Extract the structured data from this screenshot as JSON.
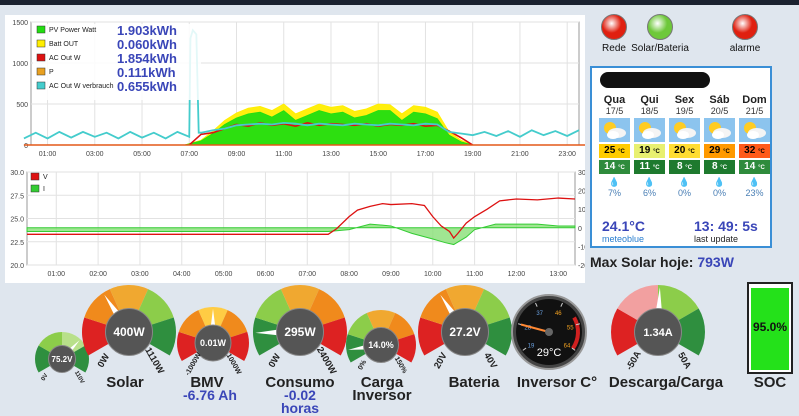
{
  "chart_data": [
    {
      "type": "area",
      "x_ticks": [
        "01:00",
        "03:00",
        "05:00",
        "07:00",
        "09:00",
        "11:00",
        "13:00",
        "15:00",
        "17:00",
        "19:00",
        "21:00",
        "23:00"
      ],
      "y_ticks": [
        "0",
        "500",
        "1000",
        "1500"
      ],
      "ylim": [
        0,
        1500
      ],
      "grid": true,
      "legend_position": "top-left",
      "series": [
        {
          "name": "PV Power Watt",
          "color": "#22dd11",
          "x": [
            6.8,
            7.5,
            8,
            8.5,
            9,
            9.5,
            10,
            10.5,
            11,
            11.5,
            12,
            12.5,
            13,
            13.5,
            14,
            14.5,
            15,
            15.5,
            16,
            16.5,
            17,
            17.5,
            18,
            18.5,
            19
          ],
          "y": [
            0,
            50,
            140,
            250,
            330,
            380,
            400,
            340,
            420,
            300,
            360,
            420,
            380,
            400,
            330,
            360,
            420,
            420,
            300,
            400,
            380,
            320,
            120,
            40,
            0
          ]
        },
        {
          "name": "Batt OUT",
          "color": "#ffee00",
          "x": [
            6.8,
            7.5,
            8,
            8.5,
            9,
            9.5,
            10,
            10.5,
            11,
            11.5,
            12,
            12.5,
            13,
            13.5,
            14,
            14.5,
            15,
            15.5,
            16,
            16.5,
            17,
            17.5,
            18,
            18.5,
            19
          ],
          "y": [
            0,
            60,
            170,
            300,
            390,
            450,
            470,
            420,
            500,
            380,
            440,
            500,
            460,
            480,
            410,
            440,
            500,
            490,
            380,
            480,
            460,
            400,
            160,
            60,
            0
          ]
        },
        {
          "name": "AC Out W",
          "color": "#dd1111",
          "x": [
            0,
            6.5,
            7,
            7.5,
            8,
            8.5,
            9,
            9.5,
            10,
            10.5,
            11,
            11.5,
            12,
            12.5,
            13,
            13.5,
            14,
            14.5,
            15,
            15.5,
            16,
            16.5,
            17,
            17.5,
            18,
            18.5,
            19,
            24
          ],
          "y": [
            0,
            0,
            0,
            130,
            150,
            200,
            250,
            230,
            270,
            240,
            260,
            230,
            270,
            240,
            260,
            250,
            240,
            260,
            230,
            250,
            240,
            260,
            230,
            240,
            170,
            90,
            0,
            0
          ]
        },
        {
          "name": "P",
          "color": "#e8a020",
          "x": [
            0,
            24
          ],
          "y": [
            0,
            0
          ]
        },
        {
          "name": "AC Out W verbrauch",
          "color": "#44cccc",
          "x": [
            0,
            0.5,
            1,
            1.5,
            2,
            2.5,
            3,
            3.5,
            4,
            4.5,
            5,
            5.5,
            6,
            6.5,
            7,
            7.05,
            7.15,
            7.3,
            7.4,
            7.5,
            8,
            8.5,
            9,
            9.5,
            10,
            10.5,
            11,
            11.5,
            12,
            12.5,
            13,
            13.5,
            14,
            14.5,
            15,
            15.5,
            16,
            16.5,
            17,
            17.5,
            18,
            18.5,
            19,
            19.5,
            20,
            20.5,
            21,
            21.5,
            22,
            22.5,
            23,
            23.5
          ],
          "y": [
            80,
            150,
            80,
            160,
            90,
            160,
            100,
            150,
            80,
            160,
            90,
            150,
            80,
            160,
            100,
            1300,
            1400,
            1350,
            150,
            150,
            180,
            200,
            240,
            250,
            260,
            250,
            270,
            260,
            240,
            260,
            250,
            240,
            260,
            250,
            240,
            260,
            250,
            240,
            260,
            250,
            160,
            140,
            120,
            160,
            110,
            170,
            100,
            180,
            120,
            170,
            110,
            180
          ]
        }
      ],
      "annotations": [
        "1.903kWh",
        "0.060kWh",
        "1.854kWh",
        "0.111kWh",
        "0.655kWh"
      ]
    },
    {
      "type": "line",
      "x_ticks": [
        "01:00",
        "02:00",
        "03:00",
        "04:00",
        "05:00",
        "06:00",
        "07:00",
        "08:00",
        "09:00",
        "10:00",
        "11:00",
        "12:00",
        "13:00"
      ],
      "y_ticks_left": [
        "20.0",
        "22.5",
        "25.0",
        "27.5",
        "30.0"
      ],
      "y_ticks_right": [
        "-20",
        "-10",
        "0",
        "10",
        "20",
        "30"
      ],
      "ylim_left": [
        20,
        30
      ],
      "ylim_right": [
        -20,
        30
      ],
      "grid": true,
      "legend_position": "top-left",
      "series": [
        {
          "name": "V",
          "color": "#dd1111",
          "axis": "left",
          "x": [
            0.3,
            7.5,
            7.7,
            8,
            8.2,
            8.5,
            8.8,
            9,
            9.5,
            9.8,
            10,
            10.2,
            10.4,
            10.5,
            10.6,
            10.8,
            11,
            11.3,
            11.6,
            12,
            12.5,
            13,
            13.4
          ],
          "y": [
            23.3,
            23.3,
            23.9,
            25.2,
            25.9,
            26.3,
            26.6,
            26.5,
            26.6,
            26.4,
            25.2,
            24.2,
            23.6,
            22.9,
            23.4,
            24.5,
            25.2,
            26.0,
            26.9,
            27.1,
            27.0,
            27.2,
            27.1
          ]
        },
        {
          "name": "I",
          "color": "#33cc33",
          "axis": "right",
          "x": [
            0.3,
            7.5,
            8,
            8.5,
            9,
            9.5,
            10,
            10.3,
            10.5,
            10.8,
            11,
            11.5,
            12,
            12.5,
            13,
            13.4
          ],
          "y": [
            -2,
            -2,
            -1,
            2,
            1,
            -3,
            -6,
            -8,
            -9,
            -5,
            -1,
            2,
            2,
            2,
            1,
            1
          ]
        }
      ]
    }
  ],
  "indicators": [
    {
      "label": "Rede",
      "color": "#e02010"
    },
    {
      "label": "Solar/Bateria",
      "color": "#6ec83a"
    },
    {
      "label": "alarme",
      "color": "#e02010"
    }
  ],
  "weather": {
    "days": [
      {
        "day": "Qua",
        "date": "17/5",
        "tmax": "25",
        "tmax_color": "#ffcc00",
        "tmin": "14",
        "tmin_color": "#2e8b3c",
        "drop": "💧",
        "pct": "7%"
      },
      {
        "day": "Qui",
        "date": "18/5",
        "tmax": "19",
        "tmax_color": "#e8f070",
        "tmin": "11",
        "tmin_color": "#1e7a2e",
        "drop": "💧",
        "pct": "6%"
      },
      {
        "day": "Sex",
        "date": "19/5",
        "tmax": "20",
        "tmax_color": "#ffdd33",
        "tmin": "8",
        "tmin_color": "#1e7a2e",
        "drop": "💧",
        "pct": "0%"
      },
      {
        "day": "Sáb",
        "date": "20/5",
        "tmax": "29",
        "tmax_color": "#ff9900",
        "tmin": "8",
        "tmin_color": "#1e7a2e",
        "drop": "💧",
        "pct": "0%"
      },
      {
        "day": "Dom",
        "date": "21/5",
        "tmax": "32",
        "tmax_color": "#ff5a1a",
        "tmin": "14",
        "tmin_color": "#2e8b3c",
        "drop": "💧",
        "pct": "23%"
      }
    ],
    "temp_unit": "°C",
    "current_temp": "24.1°C",
    "source": "meteoblue",
    "update_time": "13: 49: 5s",
    "update_label": "last update"
  },
  "max_solar": {
    "label": "Max Solar hoje:",
    "value": "793W"
  },
  "gauges": {
    "small": {
      "value": "75.2V",
      "min": "0V",
      "max": "110V",
      "level": 0.68
    },
    "solar": {
      "value": "400W",
      "min": "0W",
      "max": "1110W",
      "label": "Solar",
      "level": 0.36
    },
    "bmv": {
      "value": "0.01W",
      "min": "-1000W",
      "max": "1000W",
      "label": "BMV",
      "sub": "-6.76 Ah",
      "level": 0.5
    },
    "consumo": {
      "value": "295W",
      "min": "0W",
      "max": "2400W",
      "label": "Consumo",
      "sub_line1": "-0.02",
      "sub_line2": "horas",
      "level": 0.12
    },
    "carga": {
      "value": "14.0%",
      "min": "0%",
      "max": "150%",
      "label_line1": "Carga",
      "label_line2": "Inversor",
      "level": 0.09
    },
    "bateria": {
      "value": "27.2V",
      "min": "20V",
      "max": "40V",
      "label": "Bateria",
      "level": 0.36
    },
    "temp": {
      "value": "29°C",
      "label": "Inversor C°",
      "ticks": [
        "19",
        "28",
        "37",
        "46",
        "55",
        "64"
      ],
      "level": 0.2
    },
    "descarga": {
      "value": "1.34A",
      "min": "-50A",
      "max": "50A",
      "label": "Descarga/Carga",
      "level": 0.51
    }
  },
  "soc": {
    "label": "SOC",
    "value": "95.0%",
    "level": 0.95
  }
}
